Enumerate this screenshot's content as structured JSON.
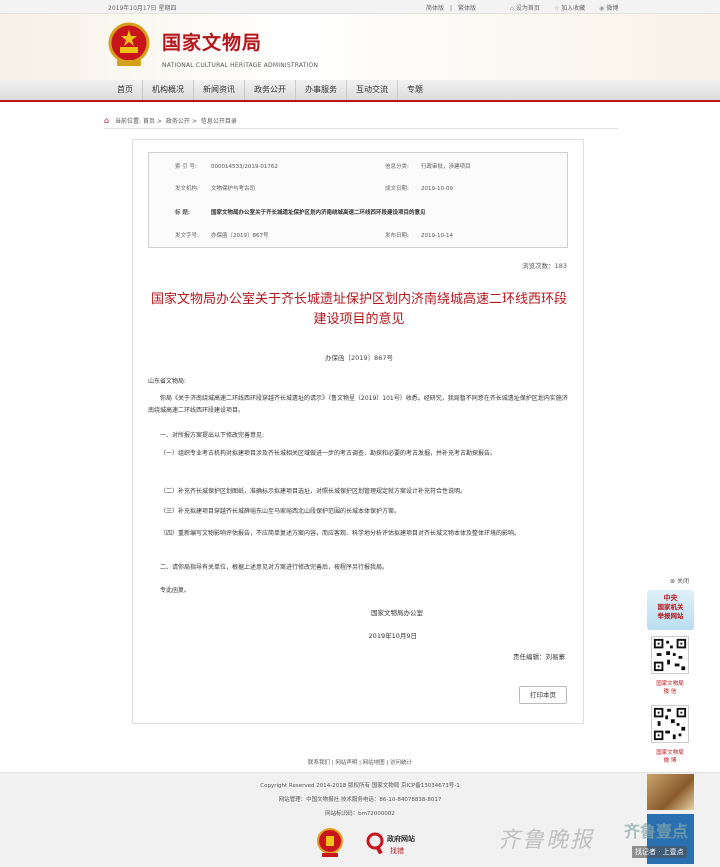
{
  "topbar": {
    "date": "2019年10月17日 星期四",
    "lang_simplified": "简体版",
    "lang_traditional": "繁体版",
    "set_home": "设为首页",
    "add_fav": "加入收藏",
    "weibo": "微博"
  },
  "header": {
    "logo_cn": "国家文物局",
    "logo_en": "NATIONAL CULTURAL HERITAGE ADMINISTRATION"
  },
  "nav": [
    "首页",
    "机构概况",
    "新闻资讯",
    "政务公开",
    "办事服务",
    "互动交流",
    "专题"
  ],
  "breadcrumb": {
    "label": "当前位置:",
    "items": [
      "首页",
      "政务公开",
      "信息公开目录"
    ]
  },
  "meta": {
    "index_label": "索 引 号:",
    "index_value": "000014533/2019-01762",
    "category_label": "信息分类:",
    "category_value": "行政审批，涉建项目",
    "issuer_label": "发文机构:",
    "issuer_value": "文物保护与考古司",
    "created_label": "成文日期:",
    "created_value": "2019-10-09",
    "title_label": "标      题:",
    "title_value": "国家文物局办公室关于齐长城遗址保护区划内济南绕城高速二环线西环段建设项目的意见",
    "docno_label": "发文字号:",
    "docno_value": "办保函〔2019〕867号",
    "published_label": "发布日期:",
    "published_value": "2019-10-14"
  },
  "views": "浏览次数：183",
  "article": {
    "title_line1": "国家文物局办公室关于齐长城遗址保护区划内济南绕城高速二环线西环段",
    "title_line2": "建设项目的意见",
    "doc_number": "办保函〔2019〕867号",
    "salutation": "山东省文物局:",
    "p1": "你局《关于济南绕城高速二环线西环段穿越齐长城遗址的请示》（鲁文物呈〔2019〕101号）收悉。经研究，我局暂不同意在齐长城遗址保护区划内实施济南绕城高速二环线西环段建设项目。",
    "p2": "一、对所报方案提出以下修改完善意见:",
    "p3": "（一）组织专业考古机构对拟建项目涉及齐长城相关区域做进一步的考古调查、勘探和必要的考古发掘，并补充考古勘探报告。",
    "p4": "（二）补充齐长城保护区划图纸，准确标示拟建项目选址，对照长城保护区划管理规定就方案设计补充符合性说明。",
    "p5": "（三）补充拟建项目穿越齐长城薛峪东山至马家峪西北山段保护范围的长城本体保护方案。",
    "p6": "（四）重新编写文物影响评估报告，不应简单复述方案内容，而应客观、科学地分析评估拟建项目对齐长城文物本体及整体环境的影响。",
    "p7": "二、请你局指导有关单位，根据上述意见对方案进行修改完善后，按程序另行报我局。",
    "closing": "专此函复。",
    "signer": "国家文物局办公室",
    "sign_date": "2019年10月9日",
    "editor": "责任编辑：刘易寨",
    "print_button": "打印本页"
  },
  "footer": {
    "links": "联系我们 | 网站声明 | 网站地图 | 访问统计",
    "copyright": "Copyright Reserved 2014-2018 版权所有 国家文物局 京ICP备13034673号-1",
    "manage": "网站管理：中国文物报社  技术服务电话：86-10-84078838-8017",
    "site_code": "网站标识码：bm72000002",
    "badge_gov_line1": "政府网站",
    "badge_gov_line2": "找错"
  },
  "floating": {
    "close": "关闭",
    "banner_line1": "中央",
    "banner_line2": "国家机关",
    "banner_line3": "举报网站",
    "qr1_caption_line1": "国家文物局",
    "qr1_caption_line2": "微 信",
    "qr2_caption_line1": "国家文物局",
    "qr2_caption_line2": "微 博"
  },
  "watermark": {
    "paper": "齐鲁晚报",
    "app": "齐鲁壹点",
    "slogan": "找记者 · 上壹点"
  },
  "colors": {
    "brand_red": "#b5161c",
    "nav_bg": "#e6e6e6",
    "footer_bg": "#f1f1f1"
  }
}
